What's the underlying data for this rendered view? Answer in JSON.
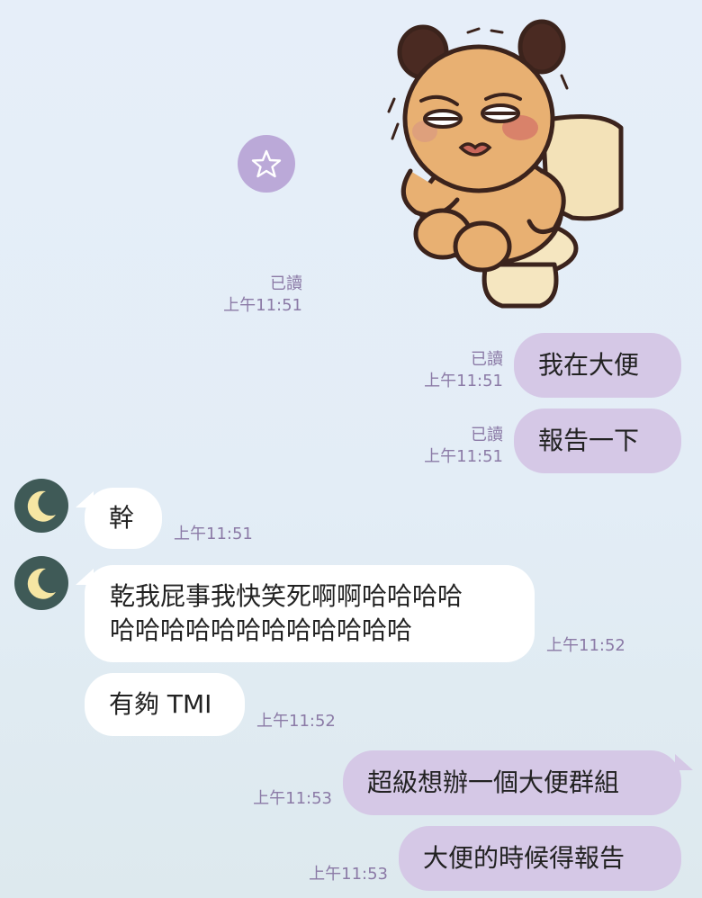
{
  "colors": {
    "outgoing_bubble": "#d5c8e6",
    "incoming_bubble": "#ffffff",
    "meta_text": "#8b7aa6",
    "avatar_bg": "#3f5a57",
    "moon": "#f6e6a3",
    "star_button": "#bba9d8"
  },
  "icons": {
    "star": "star-icon",
    "avatar": "crescent-moon-avatar",
    "sticker": "bear-on-toilet-sticker"
  },
  "messages": [
    {
      "direction": "outgoing",
      "type": "sticker",
      "read": "已讀",
      "time": "上午11:51"
    },
    {
      "direction": "outgoing",
      "type": "text",
      "text": "我在大便",
      "read": "已讀",
      "time": "上午11:51"
    },
    {
      "direction": "outgoing",
      "type": "text",
      "text": "報告一下",
      "read": "已讀",
      "time": "上午11:51"
    },
    {
      "direction": "incoming",
      "type": "text",
      "text": "幹",
      "time": "上午11:51"
    },
    {
      "direction": "incoming",
      "type": "text",
      "lines": [
        "乾我屁事我快笑死啊啊哈哈哈哈",
        "哈哈哈哈哈哈哈哈哈哈哈哈"
      ],
      "time": "上午11:52"
    },
    {
      "direction": "incoming",
      "type": "text",
      "text": "有夠 TMI",
      "time": "上午11:52"
    },
    {
      "direction": "outgoing",
      "type": "text",
      "text": "超級想辦一個大便群組",
      "time": "上午11:53"
    },
    {
      "direction": "outgoing",
      "type": "text",
      "text": "大便的時候得報告",
      "time": "上午11:53"
    }
  ]
}
